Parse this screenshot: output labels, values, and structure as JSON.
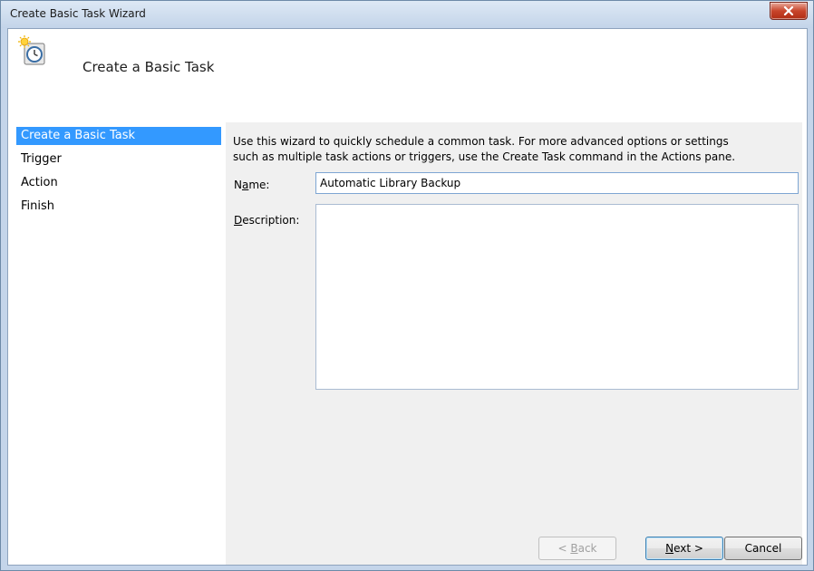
{
  "window": {
    "title": "Create Basic Task Wizard"
  },
  "header": {
    "title": "Create a Basic Task",
    "icon": "task-scheduler-clock-icon"
  },
  "steps": [
    {
      "label": "Create a Basic Task",
      "selected": true
    },
    {
      "label": "Trigger",
      "selected": false
    },
    {
      "label": "Action",
      "selected": false
    },
    {
      "label": "Finish",
      "selected": false
    }
  ],
  "content": {
    "description_line1": "Use this wizard to quickly schedule a common task.  For more advanced options or settings",
    "description_line2": "such as multiple task actions or triggers, use the Create Task command in the Actions pane.",
    "name_label_a": "N",
    "name_label_u": "a",
    "name_label_b": "me:",
    "name_value": "Automatic Library Backup",
    "description_label_u": "D",
    "description_label_b": "escription:",
    "description_value": ""
  },
  "buttons": {
    "back_pre": "< ",
    "back_u": "B",
    "back_post": "ack",
    "next_u": "N",
    "next_post": "ext >",
    "cancel": "Cancel"
  },
  "colors": {
    "selected_step": "#3399ff",
    "close_button": "#c8452b"
  }
}
